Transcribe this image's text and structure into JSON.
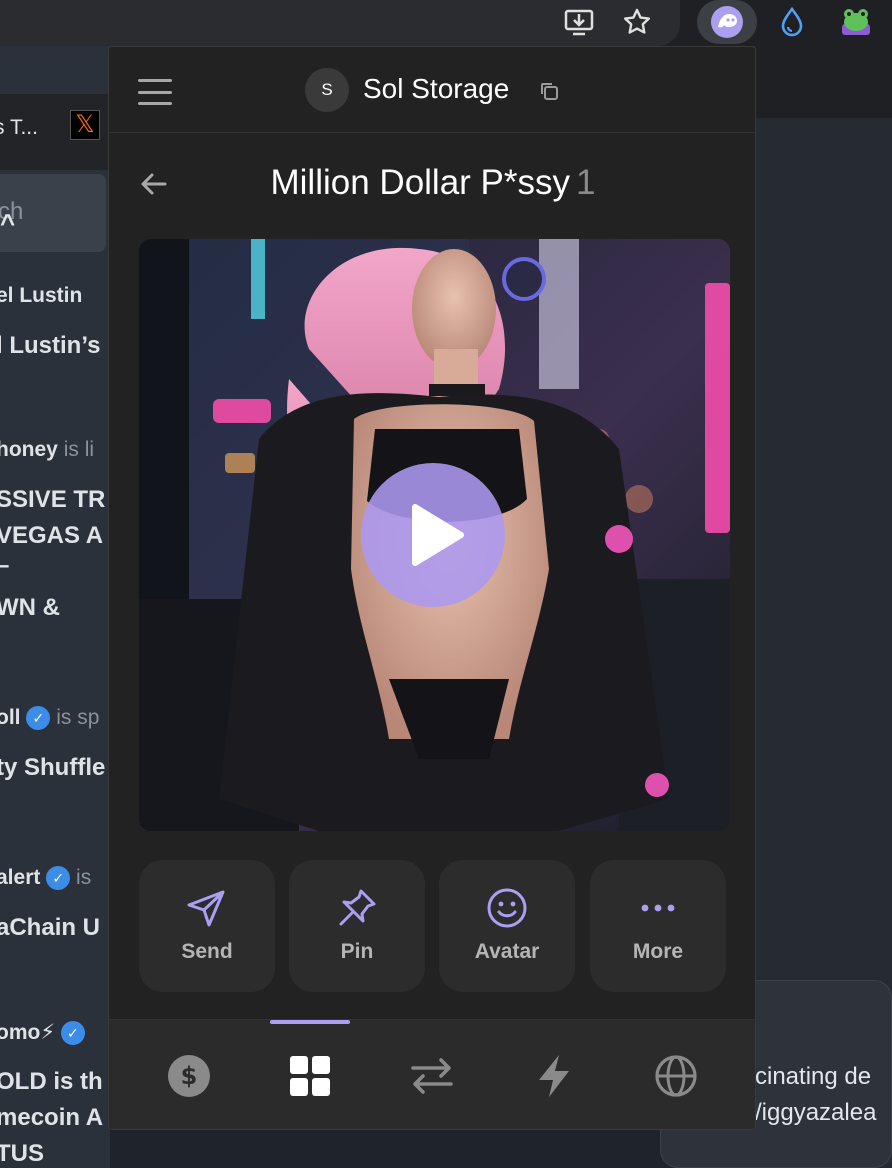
{
  "browser": {
    "tab_partial": "s T...",
    "icons": [
      "install-icon",
      "bookmark-star-icon",
      "phantom-extension-icon",
      "drop-extension-icon",
      "frog-extension-icon"
    ]
  },
  "background_page": {
    "search_partial": "ch",
    "items": [
      {
        "name": "el Lustin"
      },
      {
        "headline": "l Lustin’s"
      },
      {
        "name": "honey",
        "suffix": "is li"
      },
      {
        "headline_lines": [
          "SSIVE TR",
          "VEGAS A",
          "–",
          "WN &"
        ]
      },
      {
        "name": "oll",
        "suffix": "is sp"
      },
      {
        "headline": "ty Shuffle"
      },
      {
        "name": "alert",
        "suffix": "is"
      },
      {
        "headline": "aChain U"
      },
      {
        "name": "omo⚡"
      },
      {
        "headline_lines": [
          "OLD is th",
          "mecoin A",
          "TUS"
        ]
      }
    ],
    "right_card_lines": [
      "cinating de",
      "/iggyazalea"
    ]
  },
  "popup": {
    "account": {
      "avatar_letter": "S",
      "name": "Sol Storage"
    },
    "collectible": {
      "title": "Million Dollar P*ssy",
      "count": "1"
    },
    "actions": [
      {
        "label": "Send",
        "icon": "send-icon"
      },
      {
        "label": "Pin",
        "icon": "pin-icon"
      },
      {
        "label": "Avatar",
        "icon": "smiley-icon"
      },
      {
        "label": "More",
        "icon": "more-icon"
      }
    ],
    "tabs": [
      {
        "name": "wallet",
        "icon": "dollar-icon",
        "active": false
      },
      {
        "name": "collectibles",
        "icon": "grid-icon",
        "active": true
      },
      {
        "name": "swap",
        "icon": "swap-arrows-icon",
        "active": false
      },
      {
        "name": "activity",
        "icon": "lightning-icon",
        "active": false
      },
      {
        "name": "explore",
        "icon": "globe-icon",
        "active": false
      }
    ],
    "accent_color": "#ab9ff2"
  }
}
